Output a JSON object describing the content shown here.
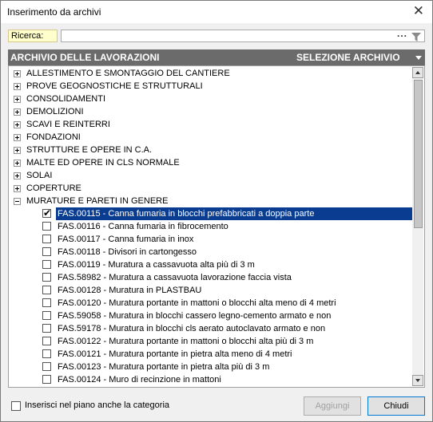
{
  "window": {
    "title": "Inserimento da archivi"
  },
  "search": {
    "label": "Ricerca:",
    "value": "",
    "more_button": "..."
  },
  "header": {
    "left": "ARCHIVIO DELLE LAVORAZIONI",
    "right": "SELEZIONE ARCHIVIO"
  },
  "tree": {
    "categories": [
      "ALLESTIMENTO E SMONTAGGIO DEL CANTIERE",
      "PROVE GEOGNOSTICHE E STRUTTURALI",
      "CONSOLIDAMENTI",
      "DEMOLIZIONI",
      "SCAVI E REINTERRI",
      "FONDAZIONI",
      "STRUTTURE E OPERE IN C.A.",
      "MALTE ED OPERE IN CLS NORMALE",
      "SOLAI",
      "COPERTURE",
      "MURATURE E PARETI IN GENERE"
    ],
    "expanded_items": [
      {
        "label": "FAS.00115 - Canna fumaria in blocchi prefabbricati a doppia parte",
        "checked": true,
        "selected": true
      },
      {
        "label": "FAS.00116 - Canna fumaria in fibrocemento",
        "checked": false,
        "selected": false
      },
      {
        "label": "FAS.00117 - Canna fumaria in inox",
        "checked": false,
        "selected": false
      },
      {
        "label": "FAS.00118 - Divisori in cartongesso",
        "checked": false,
        "selected": false
      },
      {
        "label": "FAS.00119 - Muratura a cassavuota alta più di 3 m",
        "checked": false,
        "selected": false
      },
      {
        "label": "FAS.58982 - Muratura a cassavuota lavorazione faccia vista",
        "checked": false,
        "selected": false
      },
      {
        "label": "FAS.00128 - Muratura in PLASTBAU",
        "checked": false,
        "selected": false
      },
      {
        "label": "FAS.00120 - Muratura portante in mattoni o blocchi alta meno di 4 metri",
        "checked": false,
        "selected": false
      },
      {
        "label": "FAS.59058 - Muratura in blocchi cassero legno-cemento armato e non",
        "checked": false,
        "selected": false
      },
      {
        "label": "FAS.59178 - Muratura in blocchi cls aerato autoclavato armato e non",
        "checked": false,
        "selected": false
      },
      {
        "label": "FAS.00122 - Muratura portante in mattoni o blocchi alta più di 3 m",
        "checked": false,
        "selected": false
      },
      {
        "label": "FAS.00121 - Muratura portante in pietra alta meno di 4 metri",
        "checked": false,
        "selected": false
      },
      {
        "label": "FAS.00123 - Muratura portante in pietra alta più di 3 m",
        "checked": false,
        "selected": false
      },
      {
        "label": "FAS.00124 - Muro di recinzione in mattoni",
        "checked": false,
        "selected": false
      }
    ]
  },
  "footer": {
    "checkbox_label": "Inserisci nel piano anche la categoria",
    "add_button": "Aggiungi",
    "close_button": "Chiudi"
  },
  "colors": {
    "header_bg": "#6b6b6b",
    "selection_bg": "#0a3d91",
    "search_label_bg": "#ffffcc"
  }
}
